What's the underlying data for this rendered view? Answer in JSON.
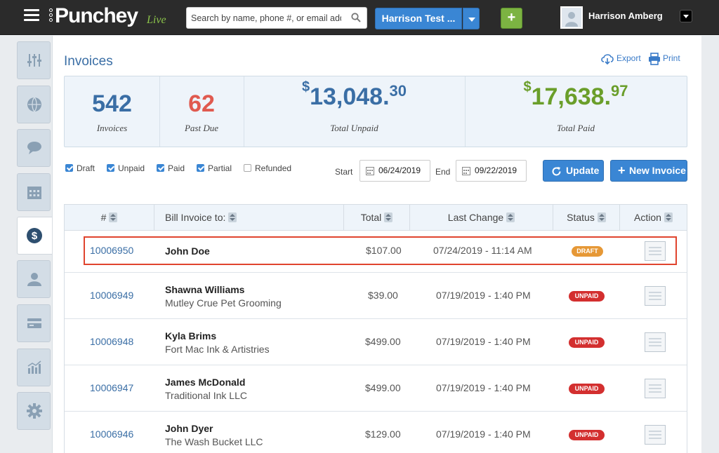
{
  "brand": {
    "name": "Punchey",
    "tag": "Live"
  },
  "search": {
    "placeholder": "Search by name, phone #, or email address"
  },
  "account": {
    "label": "Harrison Test ..."
  },
  "add_label": "+",
  "user": {
    "name": "Harrison Amberg"
  },
  "sidebar": [
    {
      "icon": "sliders-icon"
    },
    {
      "icon": "globe-icon"
    },
    {
      "icon": "chat-icon"
    },
    {
      "icon": "calendar-icon"
    },
    {
      "icon": "dollar-icon",
      "active": true
    },
    {
      "icon": "person-icon"
    },
    {
      "icon": "card-icon"
    },
    {
      "icon": "chart-icon"
    },
    {
      "icon": "gear-icon"
    }
  ],
  "page": {
    "title": "Invoices",
    "export": "Export",
    "print": "Print"
  },
  "stats": {
    "invoices": {
      "value": "542",
      "label": "Invoices",
      "color": "#3a6ea5"
    },
    "past_due": {
      "value": "62",
      "label": "Past Due",
      "color": "#e05a4f"
    },
    "unpaid": {
      "currency": "$",
      "whole": "13,048.",
      "cents": "30",
      "label": "Total Unpaid",
      "color": "#3a6ea5"
    },
    "paid": {
      "currency": "$",
      "whole": "17,638.",
      "cents": "97",
      "label": "Total Paid",
      "color": "#6a9e2a"
    }
  },
  "filters": [
    {
      "label": "Draft",
      "checked": true
    },
    {
      "label": "Unpaid",
      "checked": true
    },
    {
      "label": "Paid",
      "checked": true
    },
    {
      "label": "Partial",
      "checked": true
    },
    {
      "label": "Refunded",
      "checked": false
    }
  ],
  "dates": {
    "start_label": "Start",
    "start": "06/24/2019",
    "end_label": "End",
    "end": "09/22/2019"
  },
  "buttons": {
    "update": "Update",
    "new_invoice": "New Invoice"
  },
  "table": {
    "columns": [
      "#",
      "Bill Invoice to:",
      "Total",
      "Last Change",
      "Status",
      "Action"
    ],
    "rows": [
      {
        "number": "10006950",
        "name": "John Doe",
        "company": "",
        "total": "$107.00",
        "changed": "07/24/2019 - 11:14 AM",
        "status": "DRAFT"
      },
      {
        "number": "10006949",
        "name": "Shawna Williams",
        "company": "Mutley Crue Pet Grooming",
        "total": "$39.00",
        "changed": "07/19/2019 - 1:40 PM",
        "status": "UNPAID"
      },
      {
        "number": "10006948",
        "name": "Kyla Brims",
        "company": "Fort Mac Ink & Artistries",
        "total": "$499.00",
        "changed": "07/19/2019 - 1:40 PM",
        "status": "UNPAID"
      },
      {
        "number": "10006947",
        "name": "James McDonald",
        "company": "Traditional Ink LLC",
        "total": "$499.00",
        "changed": "07/19/2019 - 1:40 PM",
        "status": "UNPAID"
      },
      {
        "number": "10006946",
        "name": "John Dyer",
        "company": "The Wash Bucket LLC",
        "total": "$129.00",
        "changed": "07/19/2019 - 1:40 PM",
        "status": "UNPAID"
      }
    ]
  }
}
